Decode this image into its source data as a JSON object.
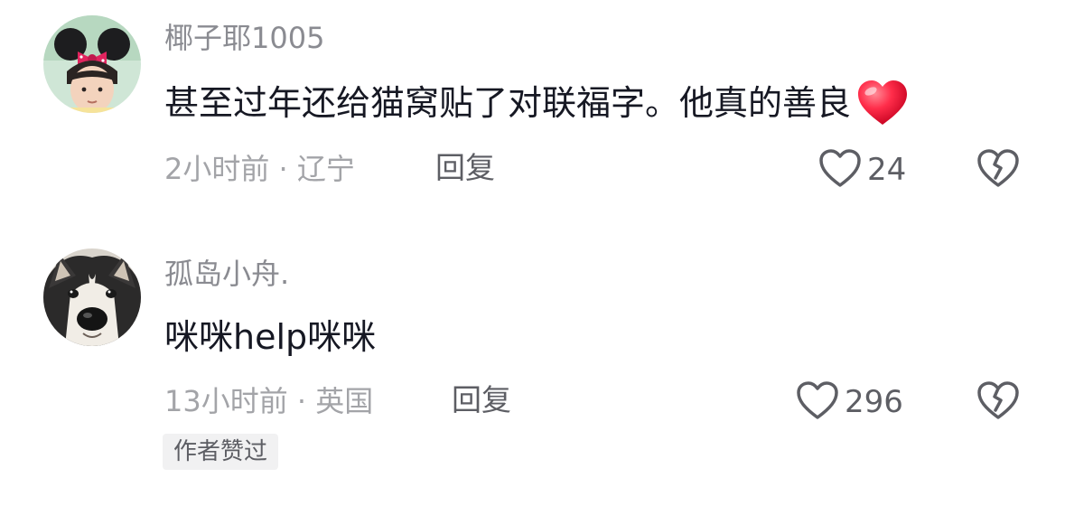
{
  "comments": [
    {
      "username": "椰子耶1005",
      "text": "甚至过年还给猫窝贴了对联福字。他真的善良",
      "emoji": "red-heart",
      "time": "2小时前",
      "separator": "·",
      "location": "辽宁",
      "reply_label": "回复",
      "like_count": "24"
    },
    {
      "username": "孤岛小舟.",
      "text": "咪咪help咪咪",
      "time": "13小时前",
      "separator": "·",
      "location": "英国",
      "reply_label": "回复",
      "like_count": "296",
      "badge": "作者赞过"
    }
  ],
  "colors": {
    "username": "#8a8b91",
    "text": "#161823",
    "meta": "#a3a4a8",
    "action": "#5d5e64",
    "badge_bg": "#f1f1f2",
    "heart": "#ff2d4a"
  }
}
